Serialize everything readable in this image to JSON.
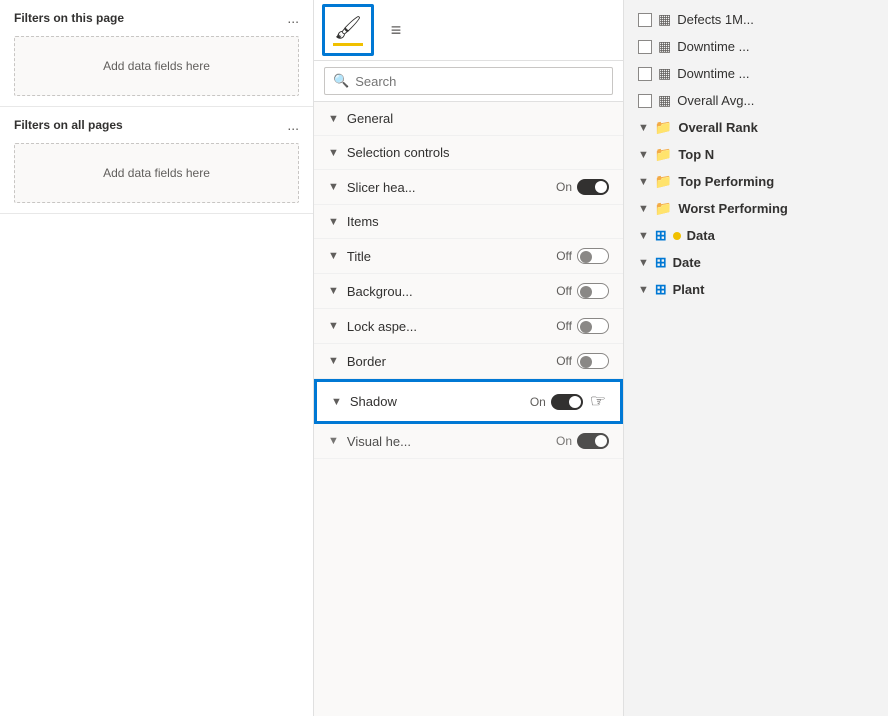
{
  "left_panel": {
    "filters_this_page": {
      "title": "Filters on this page",
      "menu_dots": "...",
      "dropzone_text": "Add data fields here"
    },
    "filters_all_pages": {
      "title": "Filters on all pages",
      "menu_dots": "...",
      "dropzone_text": "Add data fields here"
    }
  },
  "middle_panel": {
    "search_placeholder": "Search",
    "properties": [
      {
        "label": "General",
        "has_toggle": false,
        "toggle_state": null,
        "toggle_label": null
      },
      {
        "label": "Selection controls",
        "has_toggle": false,
        "toggle_state": null,
        "toggle_label": null
      },
      {
        "label": "Slicer hea...",
        "has_toggle": true,
        "toggle_state": "on",
        "toggle_label": "On"
      },
      {
        "label": "Items",
        "has_toggle": false,
        "toggle_state": null,
        "toggle_label": null
      },
      {
        "label": "Title",
        "has_toggle": true,
        "toggle_state": "off",
        "toggle_label": "Off"
      },
      {
        "label": "Backgrou...",
        "has_toggle": true,
        "toggle_state": "off",
        "toggle_label": "Off"
      },
      {
        "label": "Lock aspe...",
        "has_toggle": true,
        "toggle_state": "off",
        "toggle_label": "Off"
      },
      {
        "label": "Border",
        "has_toggle": true,
        "toggle_state": "off",
        "toggle_label": "Off"
      },
      {
        "label": "Shadow",
        "has_toggle": true,
        "toggle_state": "on",
        "toggle_label": "On",
        "highlighted": true
      },
      {
        "label": "Visual he...",
        "has_toggle": true,
        "toggle_state": "on",
        "toggle_label": "On",
        "partial": true
      }
    ]
  },
  "right_panel": {
    "fields": [
      {
        "type": "checkbox-calc",
        "name": "Defects 1M...",
        "checked": false
      },
      {
        "type": "checkbox-calc",
        "name": "Downtime ...",
        "checked": false
      },
      {
        "type": "checkbox-calc",
        "name": "Downtime ...",
        "checked": false
      },
      {
        "type": "checkbox-calc",
        "name": "Overall Avg...",
        "checked": false
      }
    ],
    "sections": [
      {
        "name": "Overall Rank",
        "icon": "folder",
        "expanded": false,
        "indent": 0
      },
      {
        "name": "Top N",
        "icon": "folder",
        "expanded": false,
        "indent": 0
      },
      {
        "name": "Top Performing",
        "icon": "folder",
        "expanded": false,
        "indent": 0
      },
      {
        "name": "Worst Performing",
        "icon": "folder",
        "expanded": false,
        "indent": 0
      },
      {
        "name": "Data",
        "icon": "table",
        "expanded": false,
        "indent": 0,
        "badge": true
      },
      {
        "name": "Date",
        "icon": "table",
        "expanded": false,
        "indent": 0
      },
      {
        "name": "Plant",
        "icon": "table",
        "expanded": false,
        "indent": 0
      }
    ]
  },
  "colors": {
    "accent_blue": "#0078d4",
    "highlight_yellow": "#f0c000",
    "dark": "#323130",
    "medium": "#605e5c"
  }
}
